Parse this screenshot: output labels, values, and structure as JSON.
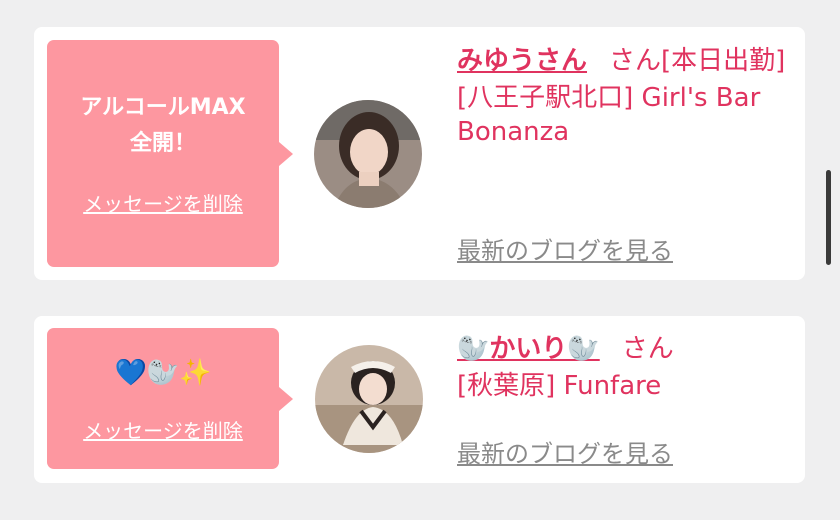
{
  "cards": [
    {
      "message": "アルコールMAX\n全開！",
      "delete_label": "メッセージを削除",
      "name": "みゆうさん",
      "suffix": "さん[本日出勤]",
      "shop": "[八王子駅北口] Girl's Bar Bonanza",
      "blog_label": "最新のブログを見る",
      "avatar_icon": "woman-portrait-photo"
    },
    {
      "message": "💙🦭✨",
      "delete_label": "メッセージを削除",
      "name": "🦭かいり🦭",
      "suffix": "さん",
      "shop": "[秋葉原] Funfare",
      "blog_label": "最新のブログを見る",
      "avatar_icon": "woman-maid-photo"
    }
  ],
  "colors": {
    "accent": "#e0335f",
    "bubble": "#fd97a0",
    "background": "#efeff0",
    "link_gray": "#8a8a8a"
  }
}
